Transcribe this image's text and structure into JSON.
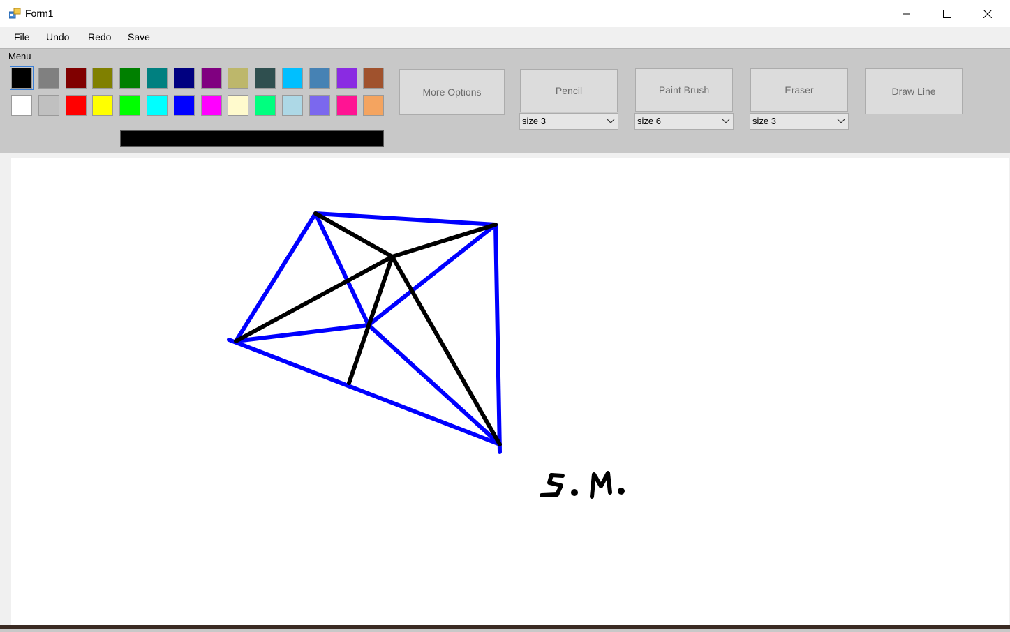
{
  "window": {
    "title": "Form1"
  },
  "menubar": {
    "items": [
      "File",
      "Undo",
      "Redo",
      "Save"
    ]
  },
  "toolbar": {
    "group_label": "Menu",
    "palette_row1": [
      "#000000",
      "#808080",
      "#800000",
      "#808000",
      "#008000",
      "#008080",
      "#000080",
      "#800080",
      "#bdb76b",
      "#2f4f4f",
      "#00bfff",
      "#4682b4",
      "#8a2be2",
      "#a0522d"
    ],
    "palette_row2": [
      "#ffffff",
      "#c0c0c0",
      "#ff0000",
      "#ffff00",
      "#00ff00",
      "#00ffff",
      "#0000ff",
      "#ff00ff",
      "#fffacd",
      "#00ff7f",
      "#add8e6",
      "#7b68ee",
      "#ff1493",
      "#f4a460"
    ],
    "current_color": "#000000",
    "more_options_label": "More Options",
    "pencil_label": "Pencil",
    "paint_brush_label": "Paint Brush",
    "eraser_label": "Eraser",
    "draw_line_label": "Draw Line",
    "pencil_size": "size 3",
    "brush_size": "size 6",
    "eraser_size": "size 3"
  },
  "canvas": {
    "signature_text": "S.M."
  }
}
